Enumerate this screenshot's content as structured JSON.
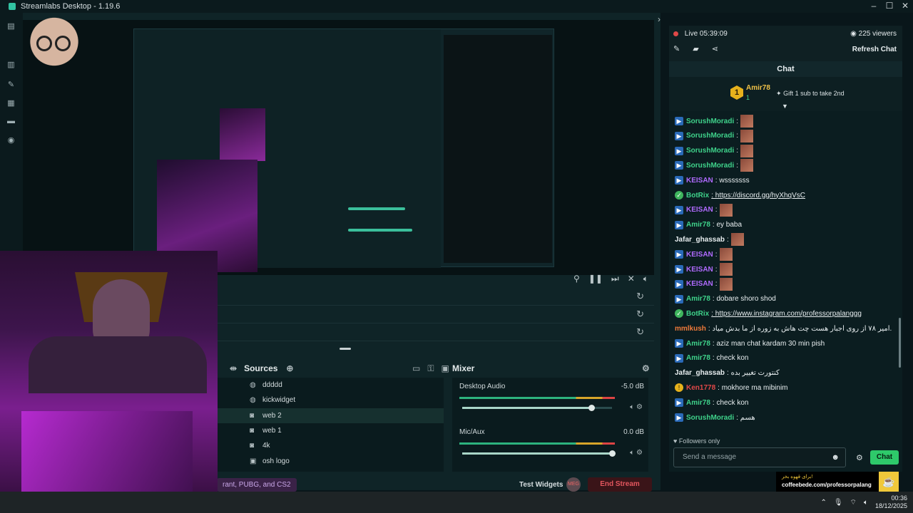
{
  "window": {
    "title": "Streamlabs Desktop - 1.19.6"
  },
  "sources": {
    "title": "Sources",
    "items": [
      {
        "label": "ddddd",
        "icon": "globe-icon"
      },
      {
        "label": "kickwidget",
        "icon": "globe-icon"
      },
      {
        "label": "web 2",
        "icon": "webcam-icon"
      },
      {
        "label": "web 1",
        "icon": "webcam-icon"
      },
      {
        "label": "4k",
        "icon": "webcam-icon"
      },
      {
        "label": "osh logo",
        "icon": "image-icon"
      }
    ]
  },
  "mixer": {
    "title": "Mixer",
    "channels": [
      {
        "name": "Desktop Audio",
        "db": "-5.0 dB",
        "level": 0.86
      },
      {
        "name": "Mic/Aux",
        "db": "0.0 dB",
        "level": 1.0
      }
    ]
  },
  "bottombar": {
    "promo": "rant, PUBG, and CS2",
    "test_widgets": "Test Widgets",
    "end_stream": "End Stream",
    "avatar_text": "MEG"
  },
  "chat": {
    "live_label": "Live",
    "live_time": "05:39:09",
    "viewers": "225 viewers",
    "refresh": "Refresh Chat",
    "header": "Chat",
    "gift_user": "Amir78",
    "gift_badge": "1",
    "gift_count": "1",
    "gift_text": "Gift 1 sub to take 2nd",
    "messages": [
      {
        "user": "SorushMoradi",
        "text": ":",
        "color": "#3fd38b",
        "badge": "blue",
        "emote": true
      },
      {
        "user": "SorushMoradi",
        "text": ":",
        "color": "#3fd38b",
        "badge": "blue",
        "emote": true
      },
      {
        "user": "SorushMoradi",
        "text": ":",
        "color": "#3fd38b",
        "badge": "blue",
        "emote": true
      },
      {
        "user": "SorushMoradi",
        "text": ":",
        "color": "#3fd38b",
        "badge": "blue",
        "emote": true
      },
      {
        "user": "KEISAN",
        "text": ": wsssssss",
        "color": "#b06aff",
        "badge": "blue",
        "emote": false
      },
      {
        "user": "BotRix",
        "text": ": https://discord.gg/hyXhqVsC",
        "color": "#3fd38b",
        "badge": "check",
        "emote": false,
        "link": true
      },
      {
        "user": "KEISAN",
        "text": ":",
        "color": "#b06aff",
        "badge": "blue",
        "emote": true
      },
      {
        "user": "Amir78",
        "text": ": ey baba",
        "color": "#3fd38b",
        "badge": "blue",
        "emote": false
      },
      {
        "user": "Jafar_ghassab",
        "text": ":",
        "color": "#e8eef0",
        "badge": "none",
        "emote": true
      },
      {
        "user": "KEISAN",
        "text": ":",
        "color": "#b06aff",
        "badge": "blue",
        "emote": true
      },
      {
        "user": "KEISAN",
        "text": ":",
        "color": "#b06aff",
        "badge": "blue",
        "emote": true
      },
      {
        "user": "KEISAN",
        "text": ":",
        "color": "#b06aff",
        "badge": "blue",
        "emote": true
      },
      {
        "user": "Amir78",
        "text": ": dobare shoro shod",
        "color": "#3fd38b",
        "badge": "blue",
        "emote": false
      },
      {
        "user": "BotRix",
        "text": ": https://www.instagram.com/professorpalanggg",
        "color": "#3fd38b",
        "badge": "check",
        "emote": false,
        "link": true
      },
      {
        "user": "mmlkush",
        "text": ": امیر ۷۸ از روی اجبار هست چت هاش به زوره از ما بدش میاد.",
        "color": "#f07a3a",
        "badge": "none",
        "emote": false
      },
      {
        "user": "Amir78",
        "text": ": aziz man chat kardam 30 min pish",
        "color": "#3fd38b",
        "badge": "blue",
        "emote": false
      },
      {
        "user": "Amir78",
        "text": ": check kon",
        "color": "#3fd38b",
        "badge": "blue",
        "emote": false
      },
      {
        "user": "Jafar_ghassab",
        "text": ": کنتورت تغییر بده",
        "color": "#e8eef0",
        "badge": "none",
        "emote": false
      },
      {
        "user": "Ken1778",
        "text": ": mokhore ma mibinim",
        "color": "#e04848",
        "badge": "gold",
        "emote": false
      },
      {
        "user": "Amir78",
        "text": ": check kon",
        "color": "#3fd38b",
        "badge": "blue",
        "emote": false
      },
      {
        "user": "SorushMoradi",
        "text": ": هسم",
        "color": "#3fd38b",
        "badge": "blue",
        "emote": false
      }
    ],
    "followers_only": "Followers only",
    "send_placeholder": "Send a message",
    "chat_button": "Chat"
  },
  "overlay": {
    "cafe_line1": "برای قهوه بخر!",
    "cafe_line2": "coffeebede.com/professorpalang"
  },
  "taskbar": {
    "time": "00:36",
    "date": "18/12/2025"
  },
  "colors": {
    "accent": "#31c3a2",
    "live_red": "#e04848",
    "chat_green": "#2ec96a",
    "end_stream": "#e2565e"
  }
}
